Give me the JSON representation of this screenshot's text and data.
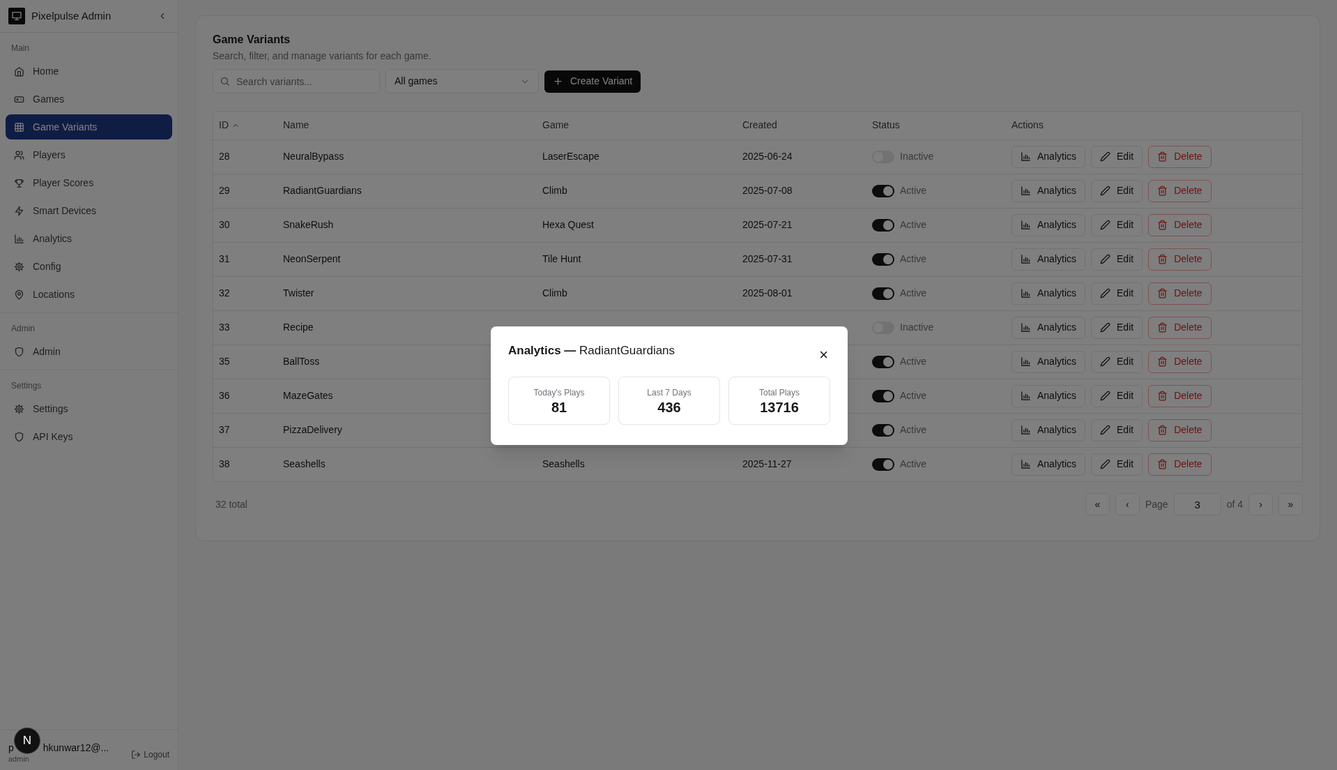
{
  "sidebar": {
    "brand": "Pixelpulse Admin",
    "sections": [
      {
        "title": "Main",
        "items": [
          {
            "label": "Home",
            "selected": false
          },
          {
            "label": "Games",
            "selected": false
          },
          {
            "label": "Game Variants",
            "selected": true
          },
          {
            "label": "Players",
            "selected": false
          },
          {
            "label": "Player Scores",
            "selected": false
          },
          {
            "label": "Smart Devices",
            "selected": false
          },
          {
            "label": "Analytics",
            "selected": false
          },
          {
            "label": "Config",
            "selected": false
          },
          {
            "label": "Locations",
            "selected": false
          }
        ]
      },
      {
        "title": "Admin",
        "items": [
          {
            "label": "Admin",
            "selected": false
          }
        ]
      },
      {
        "title": "Settings",
        "items": [
          {
            "label": "Settings",
            "selected": false
          },
          {
            "label": "API Keys",
            "selected": false
          }
        ]
      }
    ],
    "user": {
      "name_start": "p",
      "name_end": "hkunwar12@...",
      "role": "admin",
      "logout": "Logout"
    },
    "dev_badge": "N"
  },
  "page": {
    "title": "Game Variants",
    "subtitle": "Search, filter, and manage variants for each game.",
    "search": {
      "placeholder": "Search variants..."
    },
    "filter": "All games",
    "create_button": "Create Variant"
  },
  "table": {
    "columns": [
      "ID",
      "Name",
      "Game",
      "Created",
      "Status",
      "Actions"
    ],
    "rows": [
      {
        "id": "28",
        "name": "NeuralBypass",
        "game": "LaserEscape",
        "created": "2025-06-24",
        "active": false,
        "status": "Inactive",
        "actions": [
          "Analytics",
          "Edit",
          "Delete"
        ]
      },
      {
        "id": "29",
        "name": "RadiantGuardians",
        "game": "Climb",
        "created": "2025-07-08",
        "active": true,
        "status": "Active",
        "actions": [
          "Analytics",
          "Edit",
          "Delete"
        ]
      },
      {
        "id": "30",
        "name": "SnakeRush",
        "game": "Hexa Quest",
        "created": "2025-07-21",
        "active": true,
        "status": "Active",
        "actions": [
          "Analytics",
          "Edit",
          "Delete"
        ]
      },
      {
        "id": "31",
        "name": "NeonSerpent",
        "game": "Tile Hunt",
        "created": "2025-07-31",
        "active": true,
        "status": "Active",
        "actions": [
          "Analytics",
          "Edit",
          "Delete"
        ]
      },
      {
        "id": "32",
        "name": "Twister",
        "game": "Climb",
        "created": "2025-08-01",
        "active": true,
        "status": "Active",
        "actions": [
          "Analytics",
          "Edit",
          "Delete"
        ]
      },
      {
        "id": "33",
        "name": "Recipe",
        "active": false,
        "status": "Inactive",
        "actions": [
          "Analytics",
          "Edit",
          "Delete"
        ]
      },
      {
        "id": "35",
        "name": "BallToss",
        "active": true,
        "status": "Active",
        "actions": [
          "Analytics",
          "Edit",
          "Delete"
        ]
      },
      {
        "id": "36",
        "name": "MazeGates",
        "active": true,
        "status": "Active",
        "actions": [
          "Analytics",
          "Edit",
          "Delete"
        ]
      },
      {
        "id": "37",
        "name": "PizzaDelivery",
        "active": true,
        "status": "Active",
        "actions": [
          "Analytics",
          "Edit",
          "Delete"
        ]
      },
      {
        "id": "38",
        "name": "Seashells",
        "game": "Seashells",
        "created": "2025-11-27",
        "active": true,
        "status": "Active",
        "actions": [
          "Analytics",
          "Edit",
          "Delete"
        ]
      }
    ]
  },
  "footer": {
    "total": "32 total",
    "first": "«",
    "prev": "‹",
    "page_label": "Page",
    "page": "3",
    "of": "of 4",
    "next": "›",
    "last": "»"
  },
  "modal": {
    "title_bold": "Analytics —",
    "title_rest": "RadiantGuardians",
    "close": "×",
    "stats": [
      {
        "label": "Today's Plays",
        "value": "81"
      },
      {
        "label": "Last 7 Days",
        "value": "436"
      },
      {
        "label": "Total Plays",
        "value": "13716"
      }
    ]
  }
}
